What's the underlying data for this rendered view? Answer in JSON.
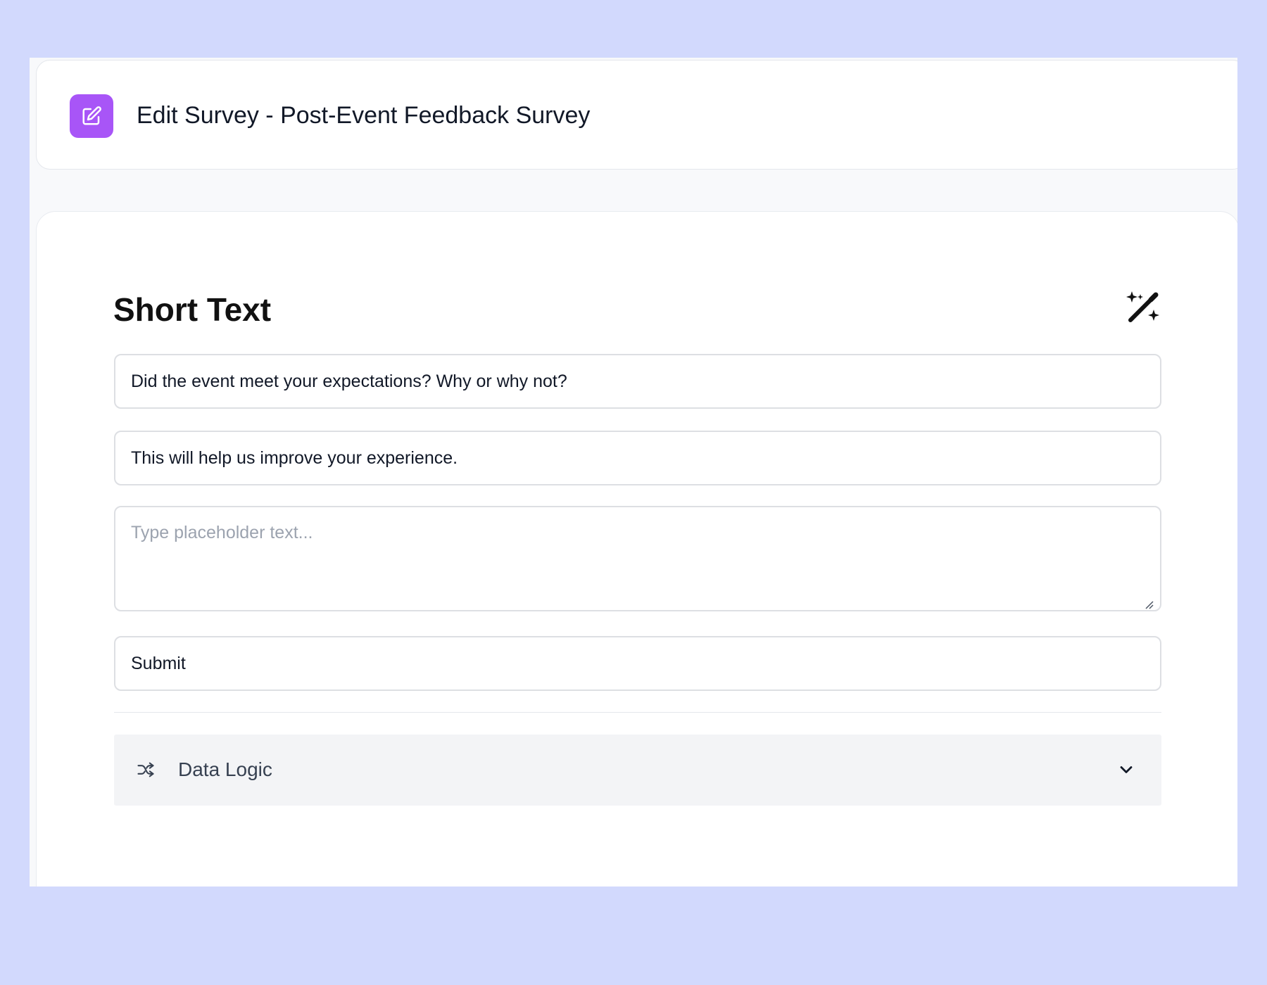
{
  "header": {
    "title": "Edit Survey - Post-Event Feedback Survey",
    "icon": "edit-square-icon",
    "accent_color": "#a855f7"
  },
  "question_editor": {
    "section_title": "Short Text",
    "magic_action_icon": "magic-wand-icon",
    "question_text": "Did the event meet your expectations? Why or why not?",
    "description_text": "This will help us improve your experience.",
    "placeholder_hint": "Type placeholder text...",
    "submit_label": "Submit"
  },
  "data_logic": {
    "label": "Data Logic",
    "icon": "shuffle-icon",
    "expand_icon": "chevron-down-icon"
  },
  "colors": {
    "page_background": "#d2d9fd",
    "surface_background": "#f8f9fb",
    "card_background": "#ffffff",
    "accordion_background": "#f3f4f6"
  }
}
